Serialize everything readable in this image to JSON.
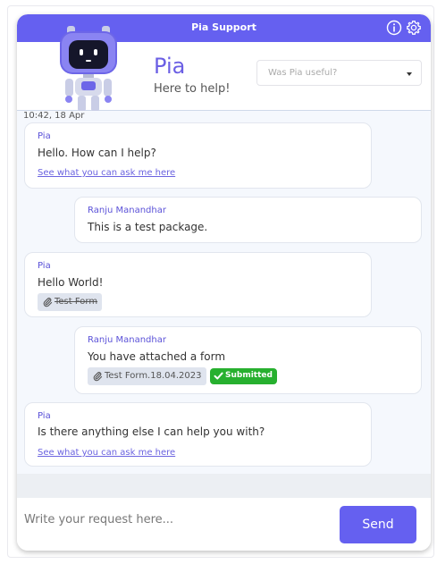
{
  "window": {
    "title": "Pia Support"
  },
  "header": {
    "bot_name": "Pia",
    "bot_subtitle": "Here to help!",
    "feedback_select": {
      "selected_text": "Was Pia useful?"
    }
  },
  "colors": {
    "accent": "#6560f0",
    "sender": "#5b52d8",
    "submitted": "#27b02f"
  },
  "icons": {
    "info": "info-icon",
    "settings": "gear-icon",
    "attachment": "paperclip-icon",
    "check": "check-icon",
    "avatar": "robot-avatar"
  },
  "chat": {
    "timestamp": "10:42, 18 Apr",
    "messages": [
      {
        "sender": "Pia",
        "text": "Hello. How can I help?",
        "link": "See what you can ask me here"
      },
      {
        "sender": "Ranju Manandhar",
        "text": "This is a test package."
      },
      {
        "sender": "Pia",
        "text": "Hello World!",
        "attachment": "Test Form"
      },
      {
        "sender": "Ranju Manandhar",
        "text": "You have attached a form",
        "attachment": "Test Form.18.04.2023",
        "status": "Submitted"
      },
      {
        "sender": "Pia",
        "text": "Is there anything else I can help you with?",
        "link": "See what you can ask me here"
      }
    ]
  },
  "composer": {
    "placeholder": "Write your request here...",
    "send_label": "Send"
  }
}
